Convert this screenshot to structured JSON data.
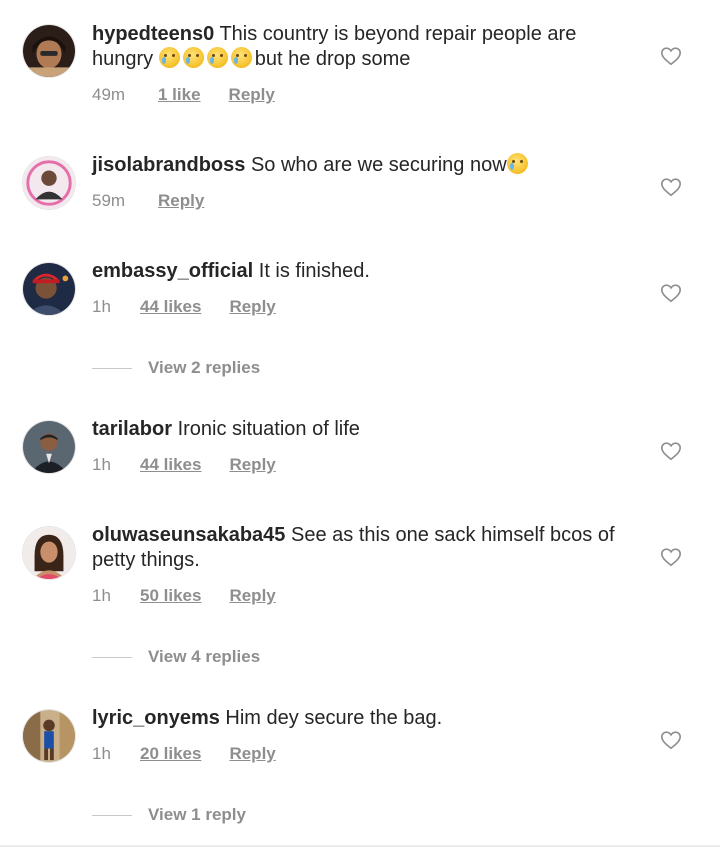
{
  "comments": [
    {
      "username": "hypedteens0",
      "text_before_emoji": "This country is beyond repair people are hungry",
      "emoji_count": 4,
      "emoji_name": "crying-face-emoji",
      "text_after_emoji": "but he drop some",
      "time": "49m",
      "likes": "1 like",
      "reply_label": "Reply"
    },
    {
      "username": "jisolabrandboss",
      "text": "So who are we securing now",
      "emoji_name": "crying-face-emoji",
      "time": "59m",
      "reply_label": "Reply"
    },
    {
      "username": "embassy_official",
      "text": "It is finished.",
      "time": "1h",
      "likes": "44 likes",
      "reply_label": "Reply",
      "view_replies": "View 2 replies"
    },
    {
      "username": "tarilabor",
      "text": "Ironic situation of life",
      "time": "1h",
      "likes": "44 likes",
      "reply_label": "Reply"
    },
    {
      "username": "oluwaseunsakaba45",
      "text": "See as this one sack himself bcos of petty things.",
      "time": "1h",
      "likes": "50 likes",
      "reply_label": "Reply",
      "view_replies": "View 4 replies"
    },
    {
      "username": "lyric_onyems",
      "text": "Him dey secure the bag.",
      "time": "1h",
      "likes": "20 likes",
      "reply_label": "Reply",
      "view_replies": "View 1 reply"
    }
  ],
  "colors": {
    "text": "#262626",
    "secondary": "#8e8e8e",
    "divider": "#c7c7c7"
  },
  "icons": {
    "like": "heart-icon",
    "emoji": "crying-face-emoji"
  }
}
